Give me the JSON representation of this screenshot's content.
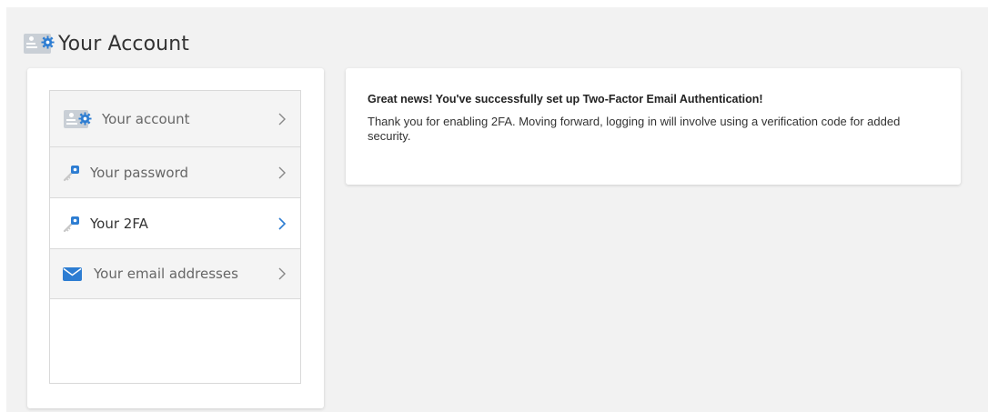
{
  "header": {
    "title": "Your Account",
    "icon": "id-card-gear-icon"
  },
  "sidebar": {
    "items": [
      {
        "label": "Your account",
        "icon": "id-card-gear-icon",
        "active": false
      },
      {
        "label": "Your password",
        "icon": "key-icon",
        "active": false
      },
      {
        "label": "Your 2FA",
        "icon": "key-icon",
        "active": true
      },
      {
        "label": "Your email addresses",
        "icon": "envelope-icon",
        "active": false
      }
    ]
  },
  "content": {
    "headline": "Great news! You've successfully set up Two-Factor Email Authentication!",
    "message": "Thank you for enabling 2FA. Moving forward, logging in will involve using a verification code for added security."
  },
  "colors": {
    "accent": "#2d7dd2",
    "icon_gray": "#c9cfd6",
    "page_bg": "#f2f2f2"
  }
}
